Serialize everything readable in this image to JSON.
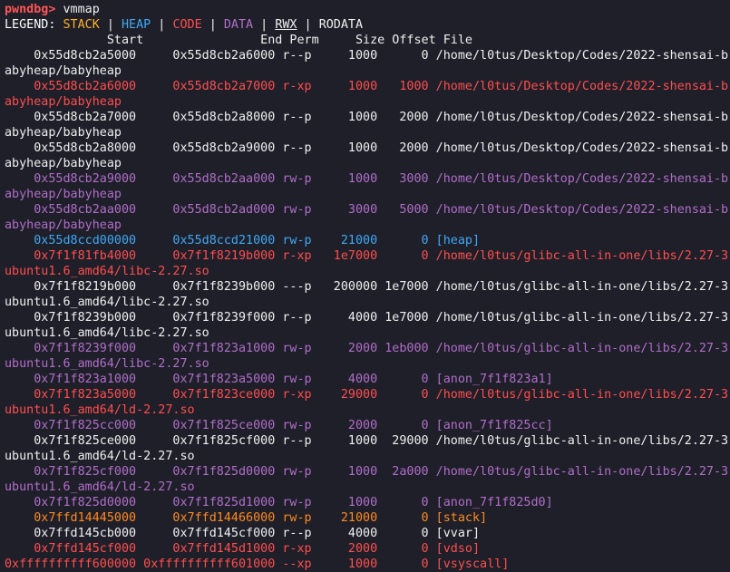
{
  "prompt": {
    "name": "pwndbg>",
    "command": "vmmap"
  },
  "legend": {
    "title": "LEGEND:",
    "items": [
      "STACK",
      "HEAP",
      "CODE",
      "DATA",
      "RWX",
      "RODATA"
    ],
    "colors": {
      "STACK": "#ffb02a",
      "HEAP": "#3fa9f5",
      "CODE": "#ff4e4e",
      "DATA": "#b16ec9",
      "RWX": "#f0f0f0",
      "RODATA": "#f0f0f0"
    }
  },
  "header": "              Start                End Perm     Size Offset File",
  "mappings": [
    {
      "line": "    0x55d8cb2a5000     0x55d8cb2a6000 r--p     1000      0 /home/l0tus/Desktop/Codes/2022-shensai-b",
      "wrap": "abyheap/babyheap",
      "color": "white"
    },
    {
      "line": "    0x55d8cb2a6000     0x55d8cb2a7000 r-xp     1000   1000 /home/l0tus/Desktop/Codes/2022-shensai-b",
      "wrap": "abyheap/babyheap",
      "color": "red"
    },
    {
      "line": "    0x55d8cb2a7000     0x55d8cb2a8000 r--p     1000   2000 /home/l0tus/Desktop/Codes/2022-shensai-b",
      "wrap": "abyheap/babyheap",
      "color": "white"
    },
    {
      "line": "    0x55d8cb2a8000     0x55d8cb2a9000 r--p     1000   2000 /home/l0tus/Desktop/Codes/2022-shensai-b",
      "wrap": "abyheap/babyheap",
      "color": "white"
    },
    {
      "line": "    0x55d8cb2a9000     0x55d8cb2aa000 rw-p     1000   3000 /home/l0tus/Desktop/Codes/2022-shensai-b",
      "wrap": "abyheap/babyheap",
      "color": "purple"
    },
    {
      "line": "    0x55d8cb2aa000     0x55d8cb2ad000 rw-p     3000   5000 /home/l0tus/Desktop/Codes/2022-shensai-b",
      "wrap": "abyheap/babyheap",
      "color": "purple"
    },
    {
      "line": "    0x55d8ccd00000     0x55d8ccd21000 rw-p    21000      0 [heap]",
      "wrap": null,
      "color": "blue"
    },
    {
      "line": "    0x7f1f81fb4000     0x7f1f8219b000 r-xp   1e7000      0 /home/l0tus/glibc-all-in-one/libs/2.27-3",
      "wrap": "ubuntu1.6_amd64/libc-2.27.so",
      "color": "red"
    },
    {
      "line": "    0x7f1f8219b000     0x7f1f8239b000 ---p   200000 1e7000 /home/l0tus/glibc-all-in-one/libs/2.27-3",
      "wrap": "ubuntu1.6_amd64/libc-2.27.so",
      "color": "white"
    },
    {
      "line": "    0x7f1f8239b000     0x7f1f8239f000 r--p     4000 1e7000 /home/l0tus/glibc-all-in-one/libs/2.27-3",
      "wrap": "ubuntu1.6_amd64/libc-2.27.so",
      "color": "white"
    },
    {
      "line": "    0x7f1f8239f000     0x7f1f823a1000 rw-p     2000 1eb000 /home/l0tus/glibc-all-in-one/libs/2.27-3",
      "wrap": "ubuntu1.6_amd64/libc-2.27.so",
      "color": "purple"
    },
    {
      "line": "    0x7f1f823a1000     0x7f1f823a5000 rw-p     4000      0 [anon_7f1f823a1]",
      "wrap": null,
      "color": "purple"
    },
    {
      "line": "    0x7f1f823a5000     0x7f1f823ce000 r-xp    29000      0 /home/l0tus/glibc-all-in-one/libs/2.27-3",
      "wrap": "ubuntu1.6_amd64/ld-2.27.so",
      "color": "red"
    },
    {
      "line": "    0x7f1f825cc000     0x7f1f825ce000 rw-p     2000      0 [anon_7f1f825cc]",
      "wrap": null,
      "color": "purple"
    },
    {
      "line": "    0x7f1f825ce000     0x7f1f825cf000 r--p     1000  29000 /home/l0tus/glibc-all-in-one/libs/2.27-3",
      "wrap": "ubuntu1.6_amd64/ld-2.27.so",
      "color": "white"
    },
    {
      "line": "    0x7f1f825cf000     0x7f1f825d0000 rw-p     1000  2a000 /home/l0tus/glibc-all-in-one/libs/2.27-3",
      "wrap": "ubuntu1.6_amd64/ld-2.27.so",
      "color": "purple"
    },
    {
      "line": "    0x7f1f825d0000     0x7f1f825d1000 rw-p     1000      0 [anon_7f1f825d0]",
      "wrap": null,
      "color": "purple"
    },
    {
      "line": "    0x7ffd14445000     0x7ffd14466000 rw-p    21000      0 [stack]",
      "wrap": null,
      "color": "orange"
    },
    {
      "line": "    0x7ffd145cb000     0x7ffd145cf000 r--p     4000      0 [vvar]",
      "wrap": null,
      "color": "white"
    },
    {
      "line": "    0x7ffd145cf000     0x7ffd145d1000 r-xp     2000      0 [vdso]",
      "wrap": null,
      "color": "red"
    },
    {
      "line": "0xffffffffff600000 0xffffffffff601000 --xp     1000      0 [vsyscall]",
      "wrap": null,
      "color": "red"
    }
  ]
}
